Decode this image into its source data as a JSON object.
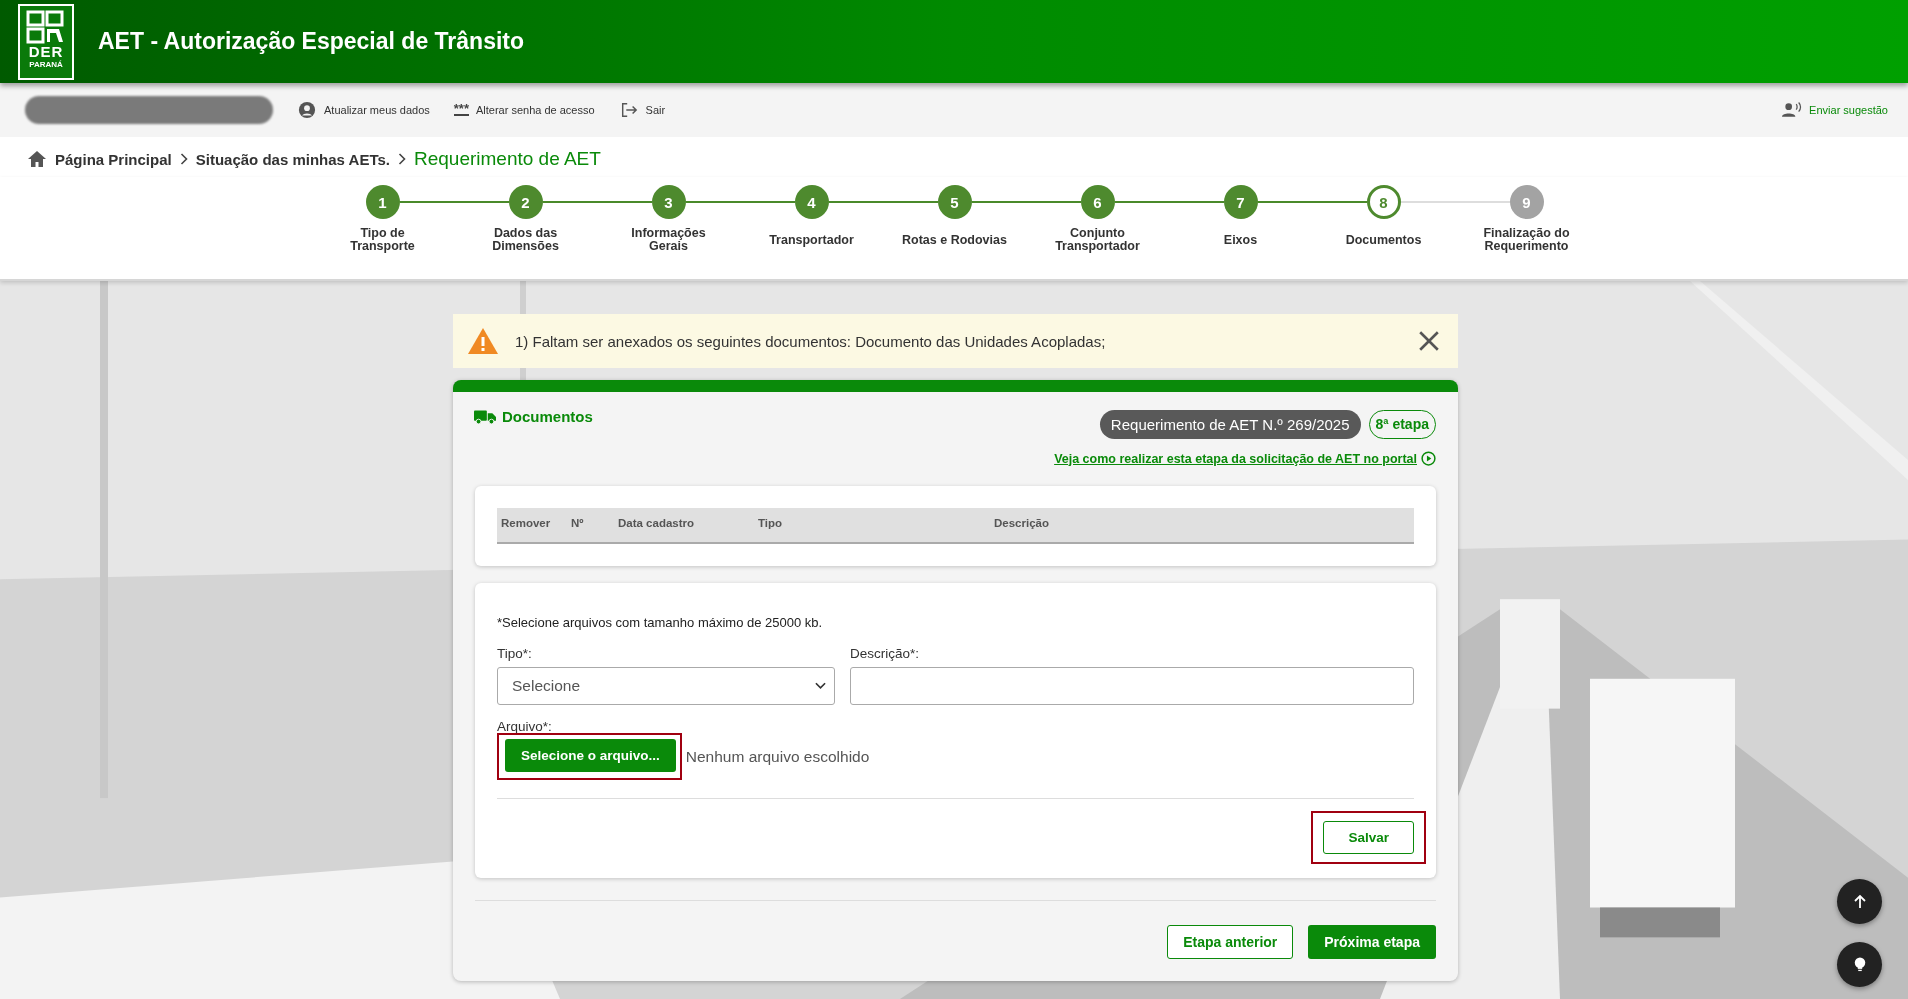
{
  "header": {
    "logo": {
      "top": "DER",
      "bottom": "PARANÁ"
    },
    "title": "AET - Autorização Especial de Trânsito"
  },
  "toolbar": {
    "links": [
      {
        "kind": "user",
        "label": "Atualizar meus dados"
      },
      {
        "kind": "password",
        "icon_text": "***",
        "label": "Alterar senha de acesso"
      },
      {
        "kind": "logout",
        "label": "Sair"
      }
    ],
    "suggestion": "Enviar sugestão"
  },
  "breadcrumb": [
    {
      "label": "Página Principal",
      "selected": false
    },
    {
      "label": "Situação das minhas AETs.",
      "selected": false
    },
    {
      "label": "Requerimento de AET",
      "selected": true
    }
  ],
  "steps": [
    {
      "number": "1",
      "label": "Tipo de Transporte",
      "completed": true,
      "selected": false
    },
    {
      "number": "2",
      "label": "Dados das Dimensões",
      "completed": true,
      "selected": false
    },
    {
      "number": "3",
      "label": "Informações Gerais",
      "completed": true,
      "selected": false
    },
    {
      "number": "4",
      "label": "Transportador",
      "completed": true,
      "selected": false
    },
    {
      "number": "5",
      "label": "Rotas e Rodovias",
      "completed": true,
      "selected": false
    },
    {
      "number": "6",
      "label": "Conjunto Transportador",
      "completed": true,
      "selected": false
    },
    {
      "number": "7",
      "label": "Eixos",
      "completed": true,
      "selected": false
    },
    {
      "number": "8",
      "label": "Documentos",
      "completed": false,
      "selected": true
    },
    {
      "number": "9",
      "label": "Finalização do Requerimento",
      "completed": false,
      "selected": false
    }
  ],
  "alert": {
    "message": "1) Faltam ser anexados os seguintes documentos: Documento das Unidades Acopladas;"
  },
  "card": {
    "title": "Documentos",
    "request_badge": "Requerimento de AET N.º 269/2025",
    "step_badge": "8ª etapa",
    "help_link": "Veja como realizar esta etapa da solicitação de AET no portal"
  },
  "table": {
    "columns": [
      "Remover",
      "Nº",
      "Data cadastro",
      "Tipo",
      "Descrição"
    ]
  },
  "form": {
    "note": "*Selecione arquivos com tamanho máximo de 25000 kb.",
    "type_label": "Tipo*:",
    "type_value": "Selecione",
    "description_label": "Descrição*:",
    "file_label": "Arquivo*:",
    "file_button": {
      "label": "Selecione o arquivo...",
      "highlighted": true
    },
    "file_status": "Nenhum arquivo escolhido",
    "save_button": {
      "label": "Salvar",
      "highlighted": true
    }
  },
  "footer_buttons": [
    {
      "kind": "secondary",
      "label": "Etapa anterior"
    },
    {
      "kind": "primary",
      "label": "Próxima etapa"
    }
  ]
}
